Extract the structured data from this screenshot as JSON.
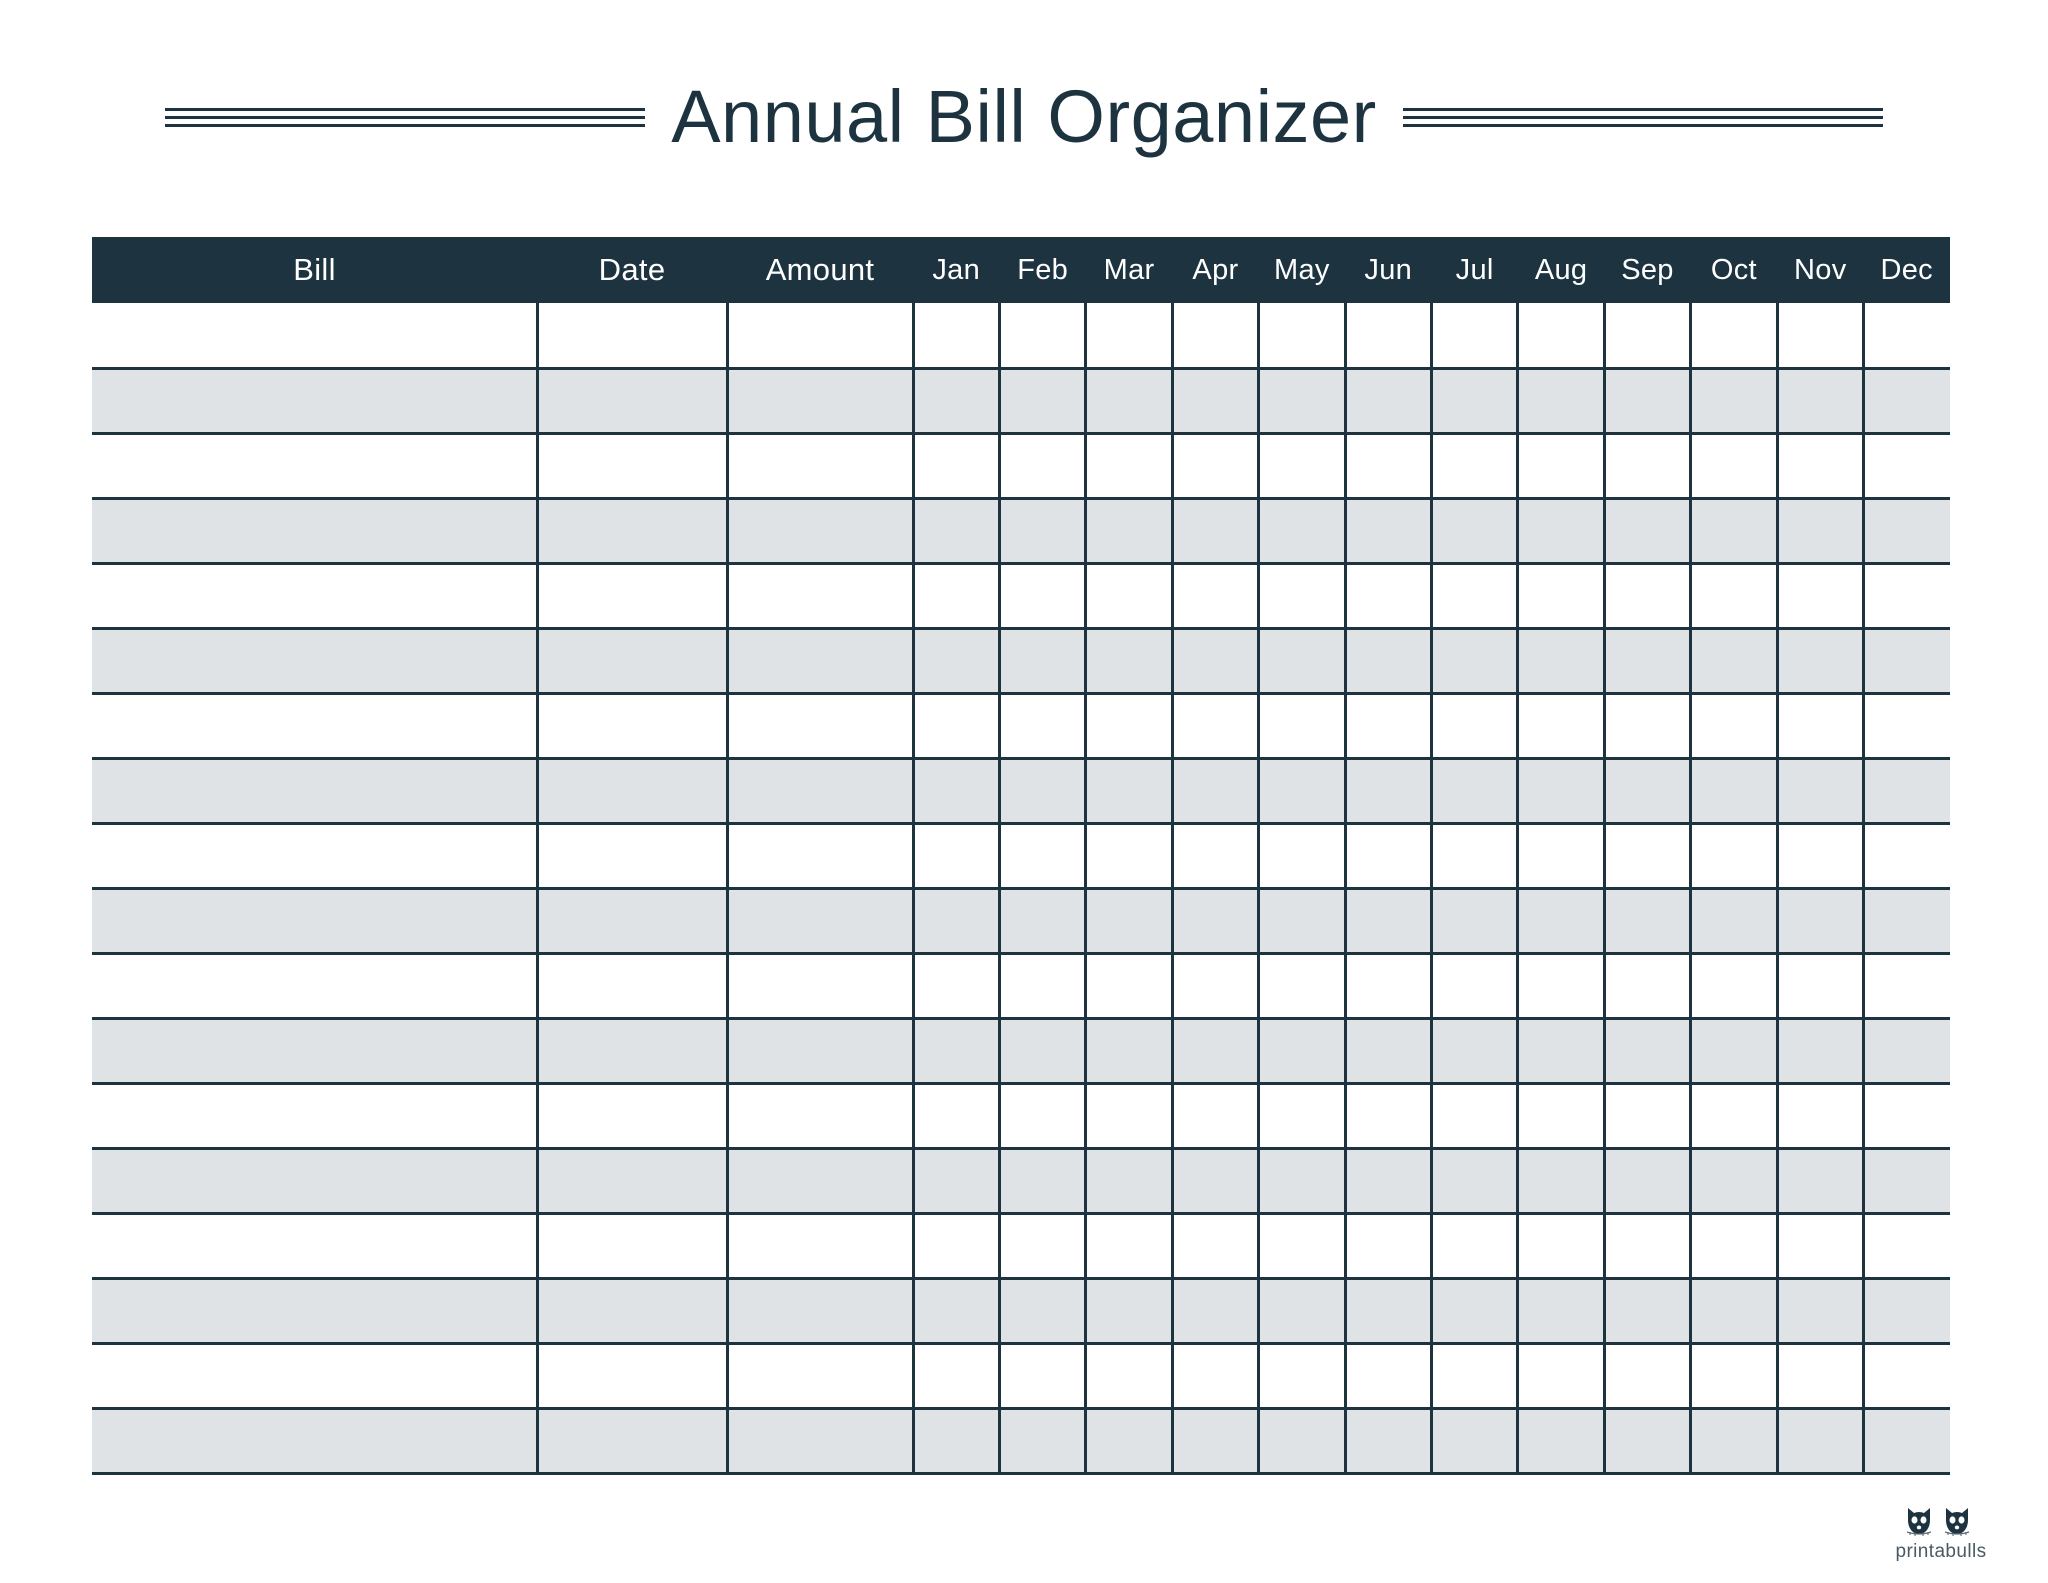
{
  "page": {
    "title": "Annual Bill Organizer",
    "background_color": "#ffffff",
    "accent_color": "#1d3440",
    "shaded_row_color": "#dfe3e6"
  },
  "decorations": {
    "rule_left_name": "decorative-rule-left",
    "rule_right_name": "decorative-rule-right",
    "rule_line_count": 3
  },
  "table": {
    "columns": [
      {
        "key": "bill",
        "label": "Bill",
        "type": "text"
      },
      {
        "key": "date",
        "label": "Date",
        "type": "text"
      },
      {
        "key": "amount",
        "label": "Amount",
        "type": "text"
      },
      {
        "key": "jan",
        "label": "Jan",
        "type": "month"
      },
      {
        "key": "feb",
        "label": "Feb",
        "type": "month"
      },
      {
        "key": "mar",
        "label": "Mar",
        "type": "month"
      },
      {
        "key": "apr",
        "label": "Apr",
        "type": "month"
      },
      {
        "key": "may",
        "label": "May",
        "type": "month"
      },
      {
        "key": "jun",
        "label": "Jun",
        "type": "month"
      },
      {
        "key": "jul",
        "label": "Jul",
        "type": "month"
      },
      {
        "key": "aug",
        "label": "Aug",
        "type": "month"
      },
      {
        "key": "sep",
        "label": "Sep",
        "type": "month"
      },
      {
        "key": "oct",
        "label": "Oct",
        "type": "month"
      },
      {
        "key": "nov",
        "label": "Nov",
        "type": "month"
      },
      {
        "key": "dec",
        "label": "Dec",
        "type": "month"
      }
    ],
    "row_count": 18,
    "rows": [
      {
        "shaded": false,
        "cells": [
          "",
          "",
          "",
          "",
          "",
          "",
          "",
          "",
          "",
          "",
          "",
          "",
          "",
          "",
          ""
        ]
      },
      {
        "shaded": true,
        "cells": [
          "",
          "",
          "",
          "",
          "",
          "",
          "",
          "",
          "",
          "",
          "",
          "",
          "",
          "",
          ""
        ]
      },
      {
        "shaded": false,
        "cells": [
          "",
          "",
          "",
          "",
          "",
          "",
          "",
          "",
          "",
          "",
          "",
          "",
          "",
          "",
          ""
        ]
      },
      {
        "shaded": true,
        "cells": [
          "",
          "",
          "",
          "",
          "",
          "",
          "",
          "",
          "",
          "",
          "",
          "",
          "",
          "",
          ""
        ]
      },
      {
        "shaded": false,
        "cells": [
          "",
          "",
          "",
          "",
          "",
          "",
          "",
          "",
          "",
          "",
          "",
          "",
          "",
          "",
          ""
        ]
      },
      {
        "shaded": true,
        "cells": [
          "",
          "",
          "",
          "",
          "",
          "",
          "",
          "",
          "",
          "",
          "",
          "",
          "",
          "",
          ""
        ]
      },
      {
        "shaded": false,
        "cells": [
          "",
          "",
          "",
          "",
          "",
          "",
          "",
          "",
          "",
          "",
          "",
          "",
          "",
          "",
          ""
        ]
      },
      {
        "shaded": true,
        "cells": [
          "",
          "",
          "",
          "",
          "",
          "",
          "",
          "",
          "",
          "",
          "",
          "",
          "",
          "",
          ""
        ]
      },
      {
        "shaded": false,
        "cells": [
          "",
          "",
          "",
          "",
          "",
          "",
          "",
          "",
          "",
          "",
          "",
          "",
          "",
          "",
          ""
        ]
      },
      {
        "shaded": true,
        "cells": [
          "",
          "",
          "",
          "",
          "",
          "",
          "",
          "",
          "",
          "",
          "",
          "",
          "",
          "",
          ""
        ]
      },
      {
        "shaded": false,
        "cells": [
          "",
          "",
          "",
          "",
          "",
          "",
          "",
          "",
          "",
          "",
          "",
          "",
          "",
          "",
          ""
        ]
      },
      {
        "shaded": true,
        "cells": [
          "",
          "",
          "",
          "",
          "",
          "",
          "",
          "",
          "",
          "",
          "",
          "",
          "",
          "",
          ""
        ]
      },
      {
        "shaded": false,
        "cells": [
          "",
          "",
          "",
          "",
          "",
          "",
          "",
          "",
          "",
          "",
          "",
          "",
          "",
          "",
          ""
        ]
      },
      {
        "shaded": true,
        "cells": [
          "",
          "",
          "",
          "",
          "",
          "",
          "",
          "",
          "",
          "",
          "",
          "",
          "",
          "",
          ""
        ]
      },
      {
        "shaded": false,
        "cells": [
          "",
          "",
          "",
          "",
          "",
          "",
          "",
          "",
          "",
          "",
          "",
          "",
          "",
          "",
          ""
        ]
      },
      {
        "shaded": true,
        "cells": [
          "",
          "",
          "",
          "",
          "",
          "",
          "",
          "",
          "",
          "",
          "",
          "",
          "",
          "",
          ""
        ]
      },
      {
        "shaded": false,
        "cells": [
          "",
          "",
          "",
          "",
          "",
          "",
          "",
          "",
          "",
          "",
          "",
          "",
          "",
          "",
          ""
        ]
      },
      {
        "shaded": true,
        "cells": [
          "",
          "",
          "",
          "",
          "",
          "",
          "",
          "",
          "",
          "",
          "",
          "",
          "",
          "",
          ""
        ]
      }
    ]
  },
  "logo": {
    "text": "printabulls",
    "mark_name": "bulldog-faces-icon",
    "color": "#1d3440"
  }
}
